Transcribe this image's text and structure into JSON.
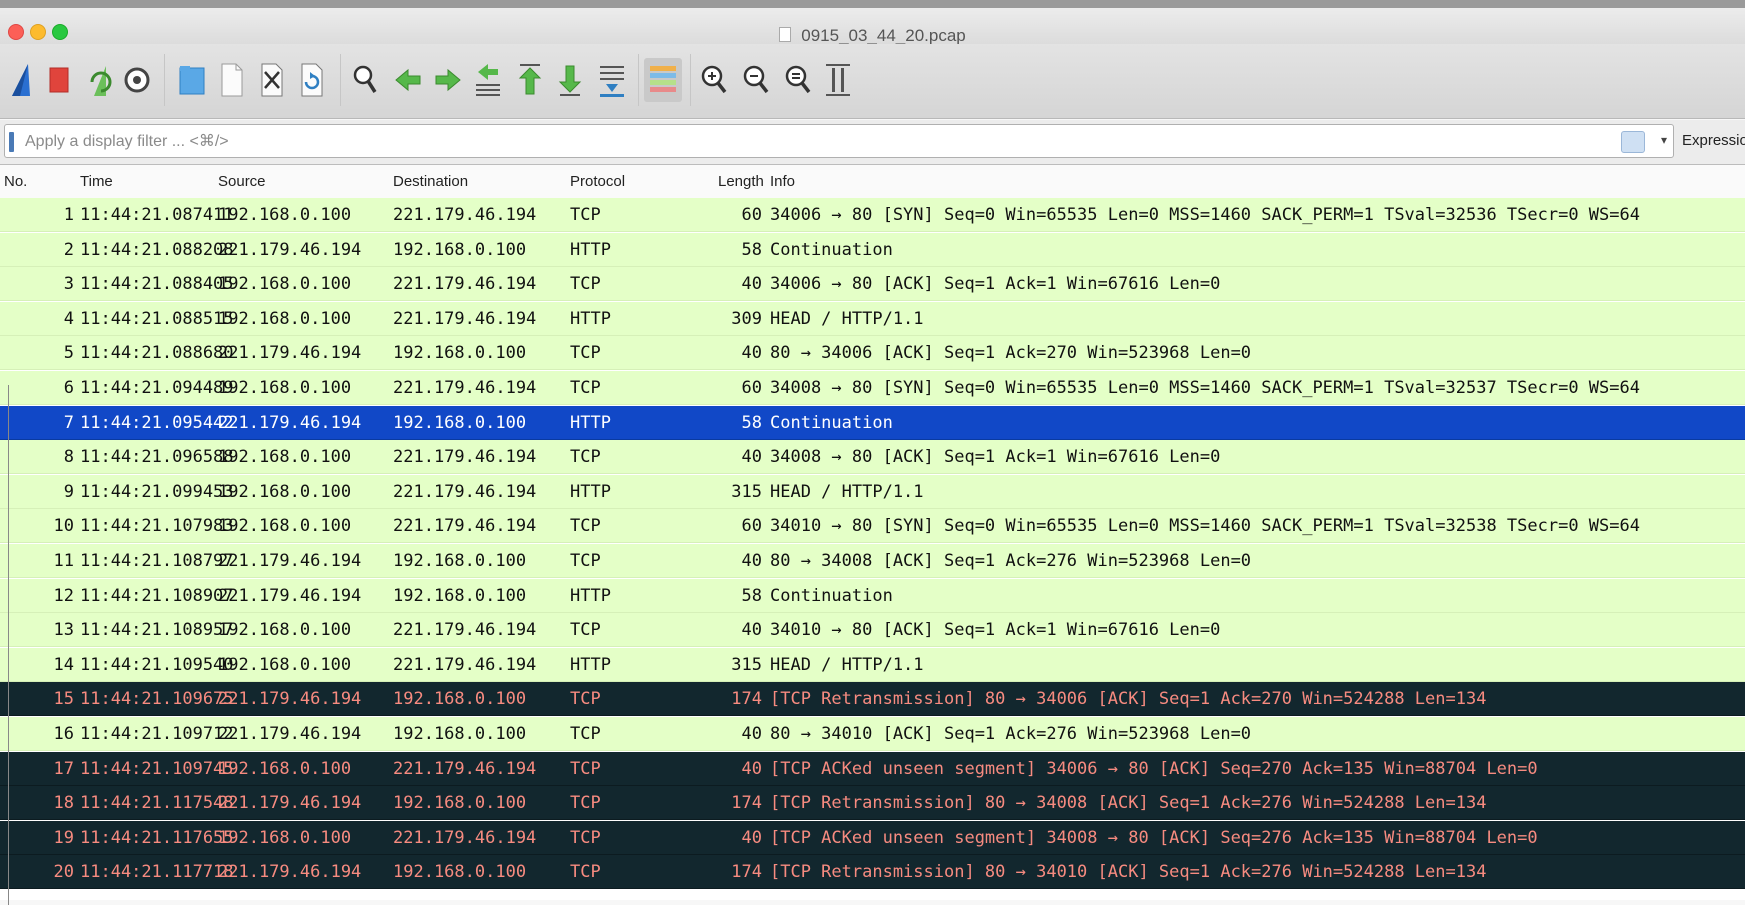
{
  "window": {
    "title": "0915_03_44_20.pcap"
  },
  "toolbar": {
    "buttons": [
      {
        "name": "start-capture-fin-icon",
        "label": "Start capture"
      },
      {
        "name": "stop-capture-icon",
        "label": "Stop capture"
      },
      {
        "name": "restart-capture-icon",
        "label": "Restart capture"
      },
      {
        "name": "capture-options-icon",
        "label": "Capture options"
      },
      {
        "name": "open-file-icon",
        "label": "Open"
      },
      {
        "name": "save-file-icon",
        "label": "Save"
      },
      {
        "name": "close-file-icon",
        "label": "Close"
      },
      {
        "name": "reload-file-icon",
        "label": "Reload"
      },
      {
        "name": "find-packet-icon",
        "label": "Find packet"
      },
      {
        "name": "go-back-icon",
        "label": "Back"
      },
      {
        "name": "go-forward-icon",
        "label": "Forward"
      },
      {
        "name": "go-to-packet-icon",
        "label": "Go to packet"
      },
      {
        "name": "go-first-icon",
        "label": "First packet"
      },
      {
        "name": "go-last-icon",
        "label": "Last packet"
      },
      {
        "name": "autoscroll-icon",
        "label": "Auto scroll"
      },
      {
        "name": "colorize-icon",
        "label": "Colorize"
      },
      {
        "name": "zoom-in-icon",
        "label": "Zoom in"
      },
      {
        "name": "zoom-out-icon",
        "label": "Zoom out"
      },
      {
        "name": "zoom-normal-icon",
        "label": "Normal size"
      },
      {
        "name": "resize-columns-icon",
        "label": "Resize columns"
      }
    ]
  },
  "filter": {
    "placeholder": "Apply a display filter ... <⌘/>",
    "value": "",
    "expression_label": "Expression..."
  },
  "columns": {
    "no": "No.",
    "time": "Time",
    "source": "Source",
    "destination": "Destination",
    "protocol": "Protocol",
    "length": "Length",
    "info": "Info"
  },
  "colors": {
    "normal_row_bg": "#e4ffc7",
    "selected_row_bg": "#1148c7",
    "bad_row_bg": "#12272e",
    "bad_row_text": "#f78b80"
  },
  "packets": [
    {
      "no": "1",
      "time": "11:44:21.087411",
      "src": "192.168.0.100",
      "dst": "221.179.46.194",
      "proto": "TCP",
      "len": "60",
      "info": "34006 → 80 [SYN] Seq=0 Win=65535 Len=0 MSS=1460 SACK_PERM=1 TSval=32536 TSecr=0 WS=64",
      "style": "normal"
    },
    {
      "no": "2",
      "time": "11:44:21.088208",
      "src": "221.179.46.194",
      "dst": "192.168.0.100",
      "proto": "HTTP",
      "len": "58",
      "info": "Continuation",
      "style": "normal"
    },
    {
      "no": "3",
      "time": "11:44:21.088405",
      "src": "192.168.0.100",
      "dst": "221.179.46.194",
      "proto": "TCP",
      "len": "40",
      "info": "34006 → 80 [ACK] Seq=1 Ack=1 Win=67616 Len=0",
      "style": "normal"
    },
    {
      "no": "4",
      "time": "11:44:21.088515",
      "src": "192.168.0.100",
      "dst": "221.179.46.194",
      "proto": "HTTP",
      "len": "309",
      "info": "HEAD / HTTP/1.1",
      "style": "normal"
    },
    {
      "no": "5",
      "time": "11:44:21.088680",
      "src": "221.179.46.194",
      "dst": "192.168.0.100",
      "proto": "TCP",
      "len": "40",
      "info": "80 → 34006 [ACK] Seq=1 Ack=270 Win=523968 Len=0",
      "style": "normal"
    },
    {
      "no": "6",
      "time": "11:44:21.094489",
      "src": "192.168.0.100",
      "dst": "221.179.46.194",
      "proto": "TCP",
      "len": "60",
      "info": "34008 → 80 [SYN] Seq=0 Win=65535 Len=0 MSS=1460 SACK_PERM=1 TSval=32537 TSecr=0 WS=64",
      "style": "normal"
    },
    {
      "no": "7",
      "time": "11:44:21.095442",
      "src": "221.179.46.194",
      "dst": "192.168.0.100",
      "proto": "HTTP",
      "len": "58",
      "info": "Continuation",
      "style": "sel"
    },
    {
      "no": "8",
      "time": "11:44:21.096588",
      "src": "192.168.0.100",
      "dst": "221.179.46.194",
      "proto": "TCP",
      "len": "40",
      "info": "34008 → 80 [ACK] Seq=1 Ack=1 Win=67616 Len=0",
      "style": "normal"
    },
    {
      "no": "9",
      "time": "11:44:21.099453",
      "src": "192.168.0.100",
      "dst": "221.179.46.194",
      "proto": "HTTP",
      "len": "315",
      "info": "HEAD / HTTP/1.1",
      "style": "normal"
    },
    {
      "no": "10",
      "time": "11:44:21.107983",
      "src": "192.168.0.100",
      "dst": "221.179.46.194",
      "proto": "TCP",
      "len": "60",
      "info": "34010 → 80 [SYN] Seq=0 Win=65535 Len=0 MSS=1460 SACK_PERM=1 TSval=32538 TSecr=0 WS=64",
      "style": "normal"
    },
    {
      "no": "11",
      "time": "11:44:21.108797",
      "src": "221.179.46.194",
      "dst": "192.168.0.100",
      "proto": "TCP",
      "len": "40",
      "info": "80 → 34008 [ACK] Seq=1 Ack=276 Win=523968 Len=0",
      "style": "normal"
    },
    {
      "no": "12",
      "time": "11:44:21.108907",
      "src": "221.179.46.194",
      "dst": "192.168.0.100",
      "proto": "HTTP",
      "len": "58",
      "info": "Continuation",
      "style": "normal"
    },
    {
      "no": "13",
      "time": "11:44:21.108957",
      "src": "192.168.0.100",
      "dst": "221.179.46.194",
      "proto": "TCP",
      "len": "40",
      "info": "34010 → 80 [ACK] Seq=1 Ack=1 Win=67616 Len=0",
      "style": "normal"
    },
    {
      "no": "14",
      "time": "11:44:21.109540",
      "src": "192.168.0.100",
      "dst": "221.179.46.194",
      "proto": "HTTP",
      "len": "315",
      "info": "HEAD / HTTP/1.1",
      "style": "normal"
    },
    {
      "no": "15",
      "time": "11:44:21.109675",
      "src": "221.179.46.194",
      "dst": "192.168.0.100",
      "proto": "TCP",
      "len": "174",
      "info": "[TCP Retransmission] 80 → 34006 [ACK] Seq=1 Ack=270 Win=524288 Len=134",
      "style": "bad"
    },
    {
      "no": "16",
      "time": "11:44:21.109712",
      "src": "221.179.46.194",
      "dst": "192.168.0.100",
      "proto": "TCP",
      "len": "40",
      "info": "80 → 34010 [ACK] Seq=1 Ack=276 Win=523968 Len=0",
      "style": "normal"
    },
    {
      "no": "17",
      "time": "11:44:21.109745",
      "src": "192.168.0.100",
      "dst": "221.179.46.194",
      "proto": "TCP",
      "len": "40",
      "info": "[TCP ACKed unseen segment] 34006 → 80 [ACK] Seq=270 Ack=135 Win=88704 Len=0",
      "style": "bad"
    },
    {
      "no": "18",
      "time": "11:44:21.117548",
      "src": "221.179.46.194",
      "dst": "192.168.0.100",
      "proto": "TCP",
      "len": "174",
      "info": "[TCP Retransmission] 80 → 34008 [ACK] Seq=1 Ack=276 Win=524288 Len=134",
      "style": "bad"
    },
    {
      "no": "19",
      "time": "11:44:21.117655",
      "src": "192.168.0.100",
      "dst": "221.179.46.194",
      "proto": "TCP",
      "len": "40",
      "info": "[TCP ACKed unseen segment] 34008 → 80 [ACK] Seq=276 Ack=135 Win=88704 Len=0",
      "style": "bad"
    },
    {
      "no": "20",
      "time": "11:44:21.117718",
      "src": "221.179.46.194",
      "dst": "192.168.0.100",
      "proto": "TCP",
      "len": "174",
      "info": "[TCP Retransmission] 80 → 34010 [ACK] Seq=1 Ack=276 Win=524288 Len=134",
      "style": "bad"
    }
  ]
}
